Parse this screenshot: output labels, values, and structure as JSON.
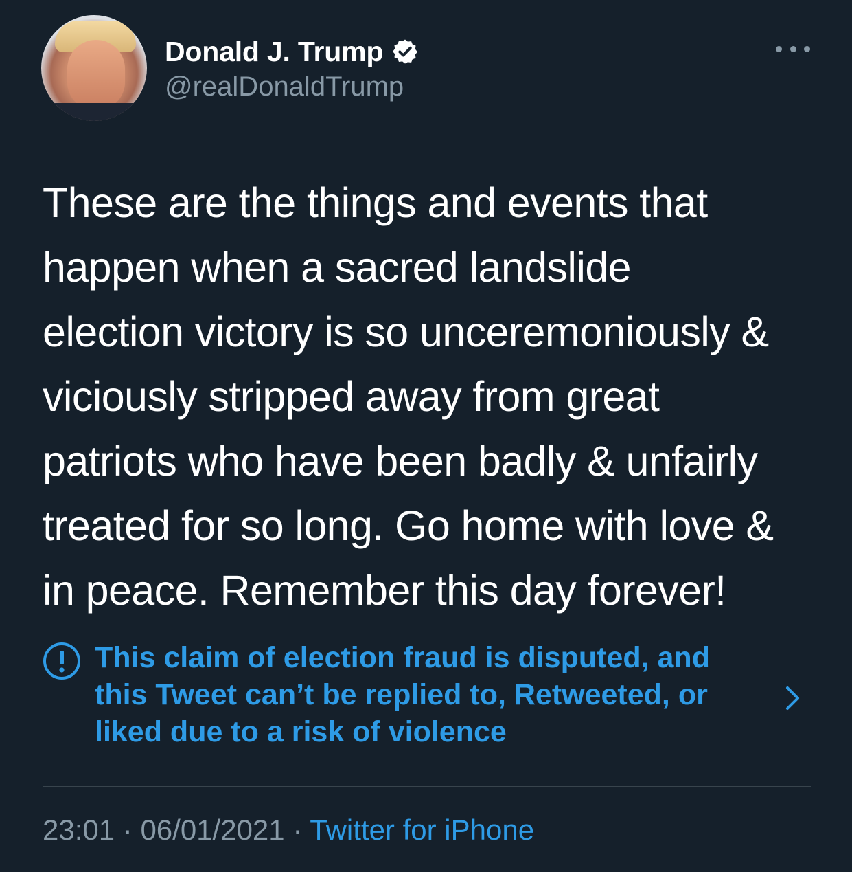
{
  "tweet": {
    "author": {
      "display_name": "Donald J. Trump",
      "handle": "@realDonaldTrump",
      "verified": true
    },
    "more_icon": "more-horizontal-icon",
    "text_lines": [
      "These are the things and events that",
      "happen when a sacred landslide",
      "election victory is so unceremoniously &",
      "viciously stripped away from great",
      "patriots who have been badly & unfairly",
      "treated for so long. Go home with love &",
      "in peace. Remember this day forever!"
    ],
    "notice": {
      "icon": "exclamation-circle-icon",
      "lines": [
        "This claim of election fraud is disputed, and",
        "this Tweet can’t be replied to, Retweeted, or",
        "liked due to a risk of violence"
      ],
      "chevron_icon": "chevron-right-icon"
    },
    "meta": {
      "time": "23:01",
      "separator": "·",
      "date": "06/01/2021",
      "source": "Twitter for iPhone"
    }
  },
  "colors": {
    "background": "#15202b",
    "text_primary": "#ffffff",
    "text_secondary": "#8899a6",
    "accent": "#2e9be6",
    "divider": "#38444d"
  }
}
